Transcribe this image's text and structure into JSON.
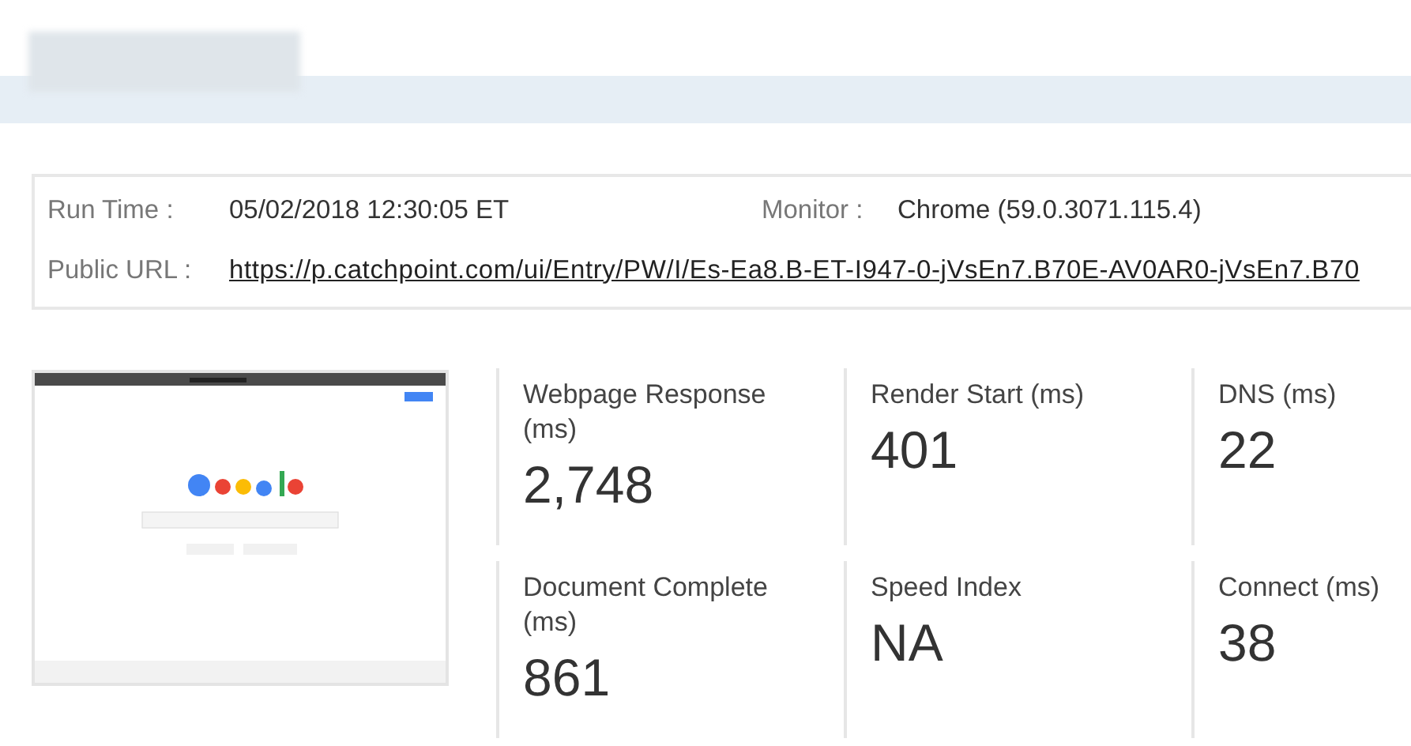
{
  "run_info": {
    "run_time_label": "Run Time :",
    "run_time": "05/02/2018 12:30:05 ET",
    "monitor_label": "Monitor :",
    "monitor": "Chrome (59.0.3071.115.4)",
    "public_url_label": "Public URL :",
    "public_url": "https://p.catchpoint.com/ui/Entry/PW/I/Es-Ea8.B-ET-I947-0-jVsEn7.B70E-AV0AR0-jVsEn7.B70"
  },
  "metrics": [
    {
      "label": "Webpage Response (ms)",
      "value": "2,748"
    },
    {
      "label": "Render Start (ms)",
      "value": "401"
    },
    {
      "label": "DNS (ms)",
      "value": "22"
    },
    {
      "label": "Document Complete (ms)",
      "value": "861"
    },
    {
      "label": "Speed Index",
      "value": "NA"
    },
    {
      "label": "Connect (ms)",
      "value": "38"
    }
  ]
}
